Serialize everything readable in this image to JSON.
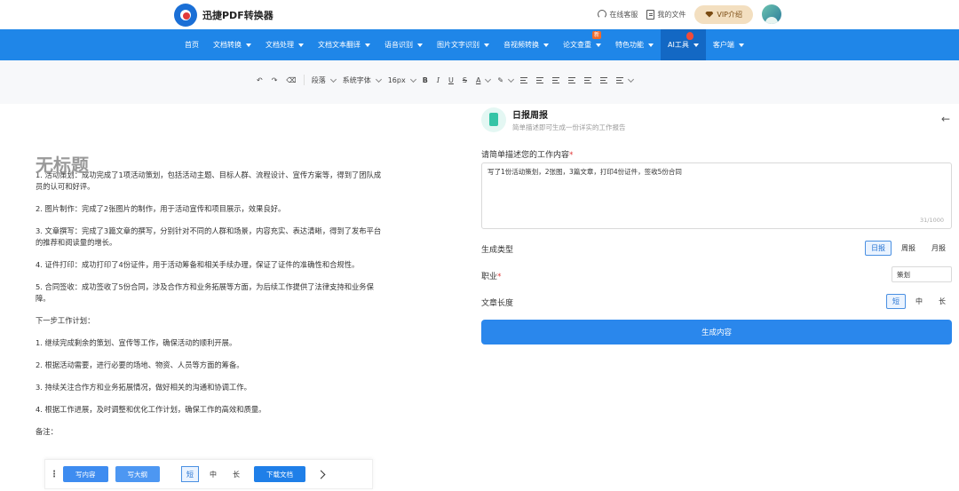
{
  "header": {
    "app_name": "迅捷PDF转换器",
    "links": [
      "在线客服",
      "我的文件"
    ],
    "vip_label": "VIP介绍"
  },
  "nav": {
    "items": [
      {
        "label": "首页",
        "caret": false
      },
      {
        "label": "文档转换",
        "caret": true
      },
      {
        "label": "文档处理",
        "caret": true
      },
      {
        "label": "文档文本翻译",
        "caret": true
      },
      {
        "label": "语音识别",
        "caret": true
      },
      {
        "label": "图片文字识别",
        "caret": true
      },
      {
        "label": "音视频转换",
        "caret": true
      },
      {
        "label": "论文查重",
        "caret": true,
        "badge": "新"
      },
      {
        "label": "特色功能",
        "caret": true
      },
      {
        "label": "AI工具",
        "caret": true,
        "active": true,
        "hot": true
      },
      {
        "label": "客户端",
        "caret": true
      }
    ]
  },
  "toolbar": {
    "paragraph": "段落",
    "font": "系统字体",
    "size": "16px",
    "bold": "B",
    "italic": "I",
    "underline": "U",
    "strike": "S",
    "font_color": "A"
  },
  "editor": {
    "title": "无标题",
    "paragraphs": [
      "1. 活动策划：成功完成了1项活动策划，包括活动主题、目标人群、流程设计、宣传方案等，得到了团队成员的认可和好评。",
      "2. 图片制作：完成了2张图片的制作，用于活动宣传和项目展示，效果良好。",
      "3. 文章撰写：完成了3篇文章的撰写，分别针对不同的人群和场景，内容充实、表达清晰，得到了发布平台的推荐和阅读量的增长。",
      "4. 证件打印：成功打印了4份证件，用于活动筹备和相关手续办理，保证了证件的准确性和合规性。",
      "5. 合同签收：成功签收了5份合同，涉及合作方和业务拓展等方面，为后续工作提供了法律支持和业务保障。",
      "下一步工作计划：",
      "1. 继续完成剩余的策划、宣传等工作，确保活动的顺利开展。",
      "2. 根据活动需要，进行必要的场地、物资、人员等方面的筹备。",
      "3. 持续关注合作方和业务拓展情况，做好相关的沟通和协调工作。",
      "4. 根据工作进展，及时调整和优化工作计划，确保工作的高效和质量。",
      "备注："
    ]
  },
  "bottom_bar": {
    "write_content": "写内容",
    "write_outline": "写大纲",
    "lengths": [
      "短",
      "中",
      "长"
    ],
    "selected_length": "短",
    "download": "下载文档"
  },
  "panel": {
    "title": "日报周报",
    "subtitle": "简单描述即可生成一份详实的工作报告",
    "describe_label": "请简单描述您的工作内容",
    "describe_value": "写了1份活动策划，2张图，3篇文章，打印4份证件，签收5份合同",
    "counter": "31/1000",
    "type_label": "生成类型",
    "types": [
      "日报",
      "周报",
      "月报"
    ],
    "job_label": "职业",
    "job_value": "策划",
    "length_label": "文章长度",
    "lengths": [
      "短",
      "中",
      "长"
    ],
    "generate": "生成内容"
  }
}
